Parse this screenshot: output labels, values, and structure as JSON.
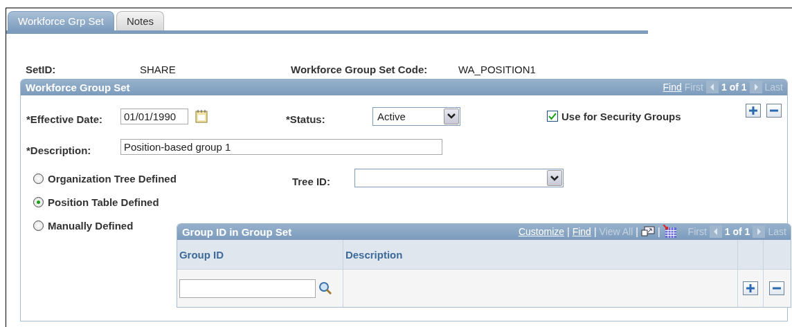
{
  "tabs": [
    {
      "label": "Workforce Grp Set",
      "selected": true
    },
    {
      "label": "Notes",
      "selected": false
    }
  ],
  "header": {
    "setid_label": "SetID:",
    "setid_value": "SHARE",
    "code_label": "Workforce Group Set Code:",
    "code_value": "WA_POSITION1"
  },
  "group_box": {
    "title": "Workforce Group Set",
    "nav": [
      {
        "kind": "link",
        "text": "Find"
      },
      {
        "kind": "disabled",
        "text": "First"
      },
      {
        "kind": "prev"
      },
      {
        "kind": "count",
        "text": "1 of 1"
      },
      {
        "kind": "next"
      },
      {
        "kind": "disabled",
        "text": "Last"
      }
    ],
    "effective_date": {
      "label": "*Effective Date:",
      "value": "01/01/1990"
    },
    "status": {
      "label": "*Status:",
      "value": "Active"
    },
    "security": {
      "label": "Use for Security Groups",
      "checked": true
    },
    "description": {
      "label": "*Description:",
      "value": "Position-based group 1"
    },
    "options": [
      {
        "label": "Organization Tree Defined",
        "selected": false
      },
      {
        "label": "Position Table Defined",
        "selected": true
      },
      {
        "label": "Manually Defined",
        "selected": false
      }
    ],
    "tree_id": {
      "label": "Tree ID:"
    },
    "grid": {
      "title": "Group ID in Group Set",
      "nav": [
        {
          "kind": "link",
          "text": "Customize"
        },
        {
          "kind": "sep",
          "text": "|"
        },
        {
          "kind": "link",
          "text": "Find"
        },
        {
          "kind": "sep",
          "text": "|"
        },
        {
          "kind": "disabled",
          "text": "View All"
        },
        {
          "kind": "sep",
          "text": "|"
        },
        {
          "kind": "zoom"
        },
        {
          "kind": "sep",
          "text": "|"
        },
        {
          "kind": "download"
        },
        {
          "kind": "disabled",
          "text": "First"
        },
        {
          "kind": "prev"
        },
        {
          "kind": "count",
          "text": "1 of 1"
        },
        {
          "kind": "next"
        },
        {
          "kind": "disabled",
          "text": "Last"
        }
      ],
      "columns": [
        "Group ID",
        "Description"
      ]
    }
  }
}
